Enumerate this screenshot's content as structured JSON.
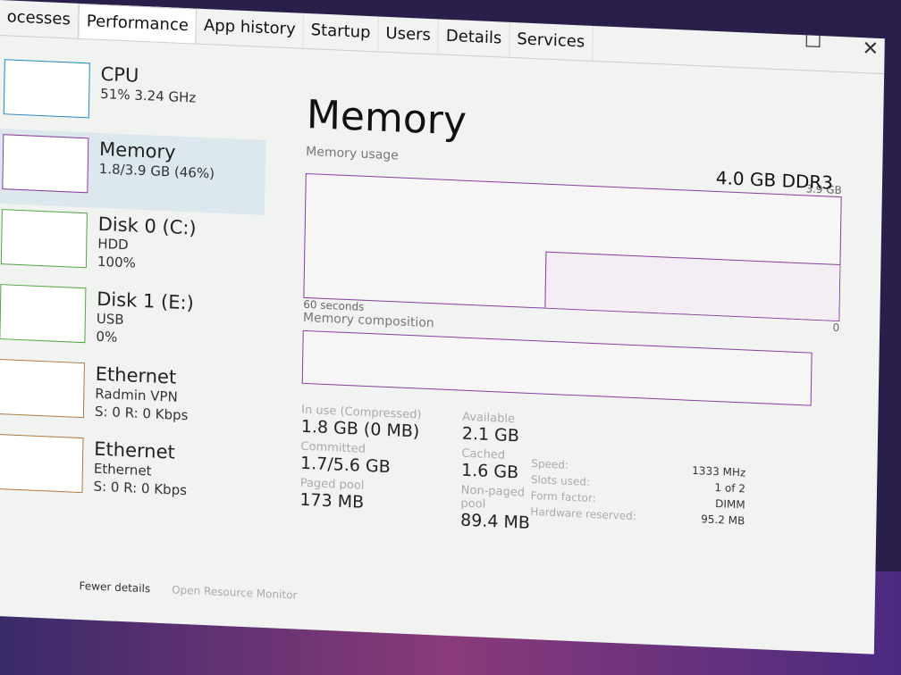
{
  "tabs": [
    "ocesses",
    "Performance",
    "App history",
    "Startup",
    "Users",
    "Details",
    "Services"
  ],
  "active_tab": "Performance",
  "sidebar": [
    {
      "name": "CPU",
      "sub1": "51% 3.24 GHz",
      "sub2": "",
      "sub3": ""
    },
    {
      "name": "Memory",
      "sub1": "1.8/3.9 GB (46%)",
      "sub2": "",
      "sub3": ""
    },
    {
      "name": "Disk 0 (C:)",
      "sub1": "HDD",
      "sub2": "100%",
      "sub3": ""
    },
    {
      "name": "Disk 1 (E:)",
      "sub1": "USB",
      "sub2": "0%",
      "sub3": ""
    },
    {
      "name": "Ethernet",
      "sub1": "Radmin VPN",
      "sub2": "S: 0 R: 0 Kbps",
      "sub3": ""
    },
    {
      "name": "Ethernet",
      "sub1": "Ethernet",
      "sub2": "S: 0 R: 0 Kbps",
      "sub3": ""
    }
  ],
  "main": {
    "title": "Memory",
    "ram_type": "4.0 GB DDR3",
    "usage_label": "Memory usage",
    "usage_max": "3.9 GB",
    "time_label": "60 seconds",
    "zero": "0",
    "composition_label": "Memory composition",
    "usage_fraction": 0.46,
    "stats": {
      "in_use_label": "In use (Compressed)",
      "in_use": "1.8 GB (0 MB)",
      "available_label": "Available",
      "available": "2.1 GB",
      "committed_label": "Committed",
      "committed": "1.7/5.6 GB",
      "cached_label": "Cached",
      "cached": "1.6 GB",
      "paged_label": "Paged pool",
      "paged": "173 MB",
      "nonpaged_label": "Non-paged pool",
      "nonpaged": "89.4 MB"
    },
    "specs": {
      "speed_label": "Speed:",
      "speed": "1333 MHz",
      "slots_label": "Slots used:",
      "slots": "1 of 2",
      "form_label": "Form factor:",
      "form": "DIMM",
      "hw_label": "Hardware reserved:",
      "hw": "95.2 MB"
    }
  },
  "footer": {
    "fewer": "Fewer details",
    "monitor": "Open Resource Monitor"
  },
  "colors": {
    "memory": "#8b3aa0",
    "cpu": "#1a84c7",
    "disk": "#4ca83c",
    "net": "#b0763a"
  }
}
